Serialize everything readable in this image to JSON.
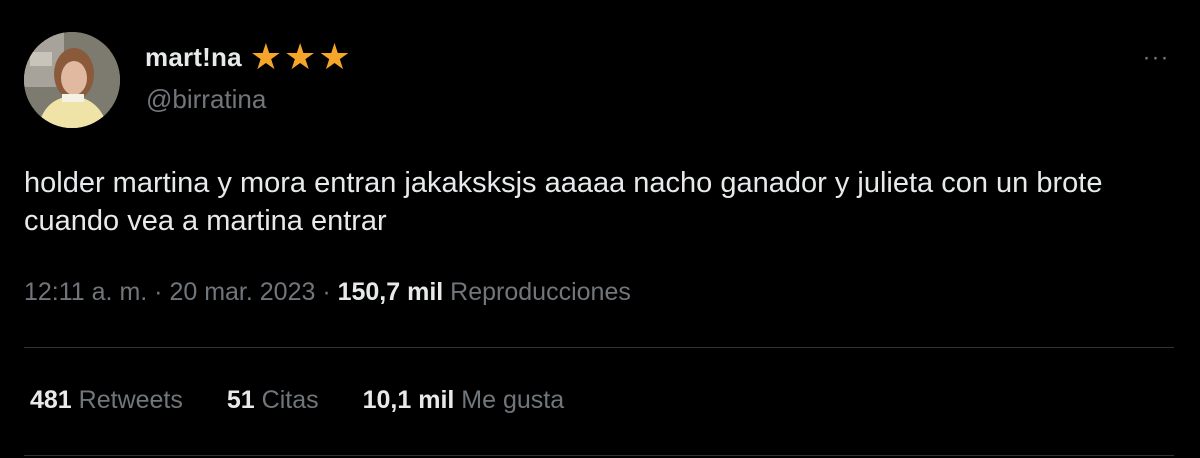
{
  "user": {
    "display_name": "mart!na",
    "handle": "@birratina",
    "avatar_icon": "profile-photo",
    "badge_icons": [
      "star-icon",
      "star-icon",
      "star-icon"
    ],
    "badge_symbol": "★",
    "badge_color": "#f4a52a"
  },
  "more_menu": {
    "icon": "more-dots-icon",
    "label": "···"
  },
  "tweet": {
    "text": "holder martina y mora entran jakaksksjs aaaaa nacho ganador y julieta con un brote cuando vea a martina entrar",
    "time": "12:11 a. m.",
    "sep1": " · ",
    "date": "20 mar. 2023",
    "sep2": " · ",
    "views_count": "150,7 mil",
    "views_label": " Reproducciones"
  },
  "stats": {
    "retweets": {
      "count": "481",
      "label": " Retweets"
    },
    "quotes": {
      "count": "51",
      "label": " Citas"
    },
    "likes": {
      "count": "10,1 mil",
      "label": " Me gusta"
    }
  },
  "colors": {
    "background": "#000000",
    "text": "#e7e9ea",
    "secondary": "#71767b",
    "divider": "#2f3336"
  }
}
